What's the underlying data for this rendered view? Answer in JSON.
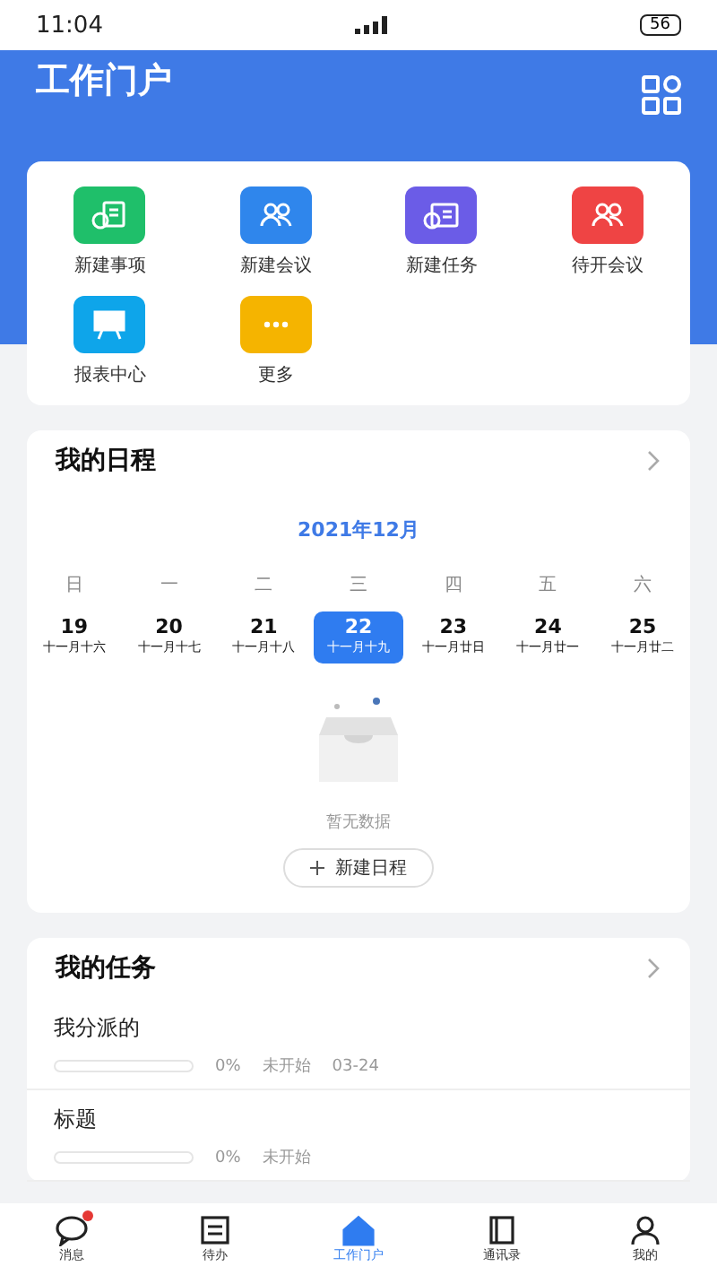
{
  "status_bar": {
    "time": "11:04",
    "battery": "56"
  },
  "header": {
    "title": "工作门户"
  },
  "shortcuts": [
    {
      "label": "新建事项",
      "kind": "doc",
      "color": "#1fbf6a"
    },
    {
      "label": "新建会议",
      "kind": "people",
      "color": "#2f86ec"
    },
    {
      "label": "新建任务",
      "kind": "task",
      "color": "#6b5ce7"
    },
    {
      "label": "待开会议",
      "kind": "people",
      "color": "#ef4444"
    },
    {
      "label": "报表中心",
      "kind": "board",
      "color": "#0ea5ea"
    },
    {
      "label": "更多",
      "kind": "more",
      "color": "#f5b400"
    }
  ],
  "schedule": {
    "title": "我的日程",
    "month": "2021年12月",
    "weekdays": [
      "日",
      "一",
      "二",
      "三",
      "四",
      "五",
      "六"
    ],
    "days": [
      {
        "date": "19",
        "lunar": "十一月十六",
        "selected": false
      },
      {
        "date": "20",
        "lunar": "十一月十七",
        "selected": false
      },
      {
        "date": "21",
        "lunar": "十一月十八",
        "selected": false
      },
      {
        "date": "22",
        "lunar": "十一月十九",
        "selected": true
      },
      {
        "date": "23",
        "lunar": "十一月廿日",
        "selected": false
      },
      {
        "date": "24",
        "lunar": "十一月廿一",
        "selected": false
      },
      {
        "date": "25",
        "lunar": "十一月廿二",
        "selected": false
      }
    ],
    "empty_text": "暂无数据",
    "add_button": "新建日程"
  },
  "tasks": {
    "title": "我的任务",
    "items": [
      {
        "title": "我分派的",
        "level": 0,
        "percent": "0%",
        "status": "未开始",
        "date": "03-24"
      },
      {
        "title": "标题",
        "level": 0,
        "percent": "0%",
        "status": "未开始"
      }
    ]
  },
  "tab_bar": [
    {
      "label": "消息",
      "kind": "chat",
      "badge": true,
      "selected": false
    },
    {
      "label": "待办",
      "kind": "todo",
      "badge": false,
      "selected": false
    },
    {
      "label": "工作门户",
      "kind": "home",
      "badge": false,
      "selected": true
    },
    {
      "label": "通讯录",
      "kind": "book",
      "badge": false,
      "selected": false
    },
    {
      "label": "我的",
      "kind": "user",
      "badge": false,
      "selected": false
    }
  ]
}
